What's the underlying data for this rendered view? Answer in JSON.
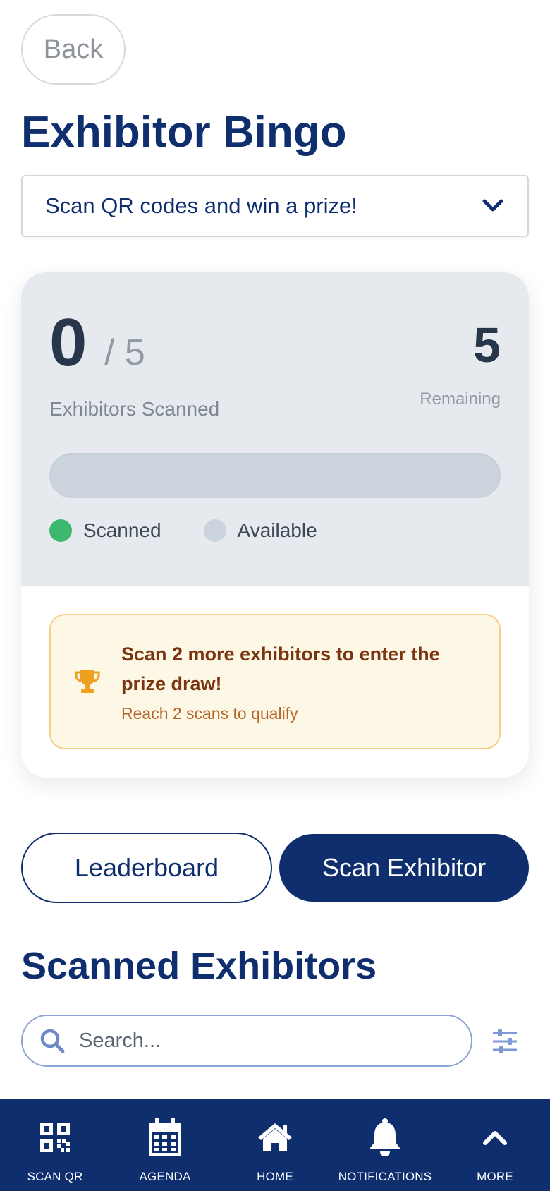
{
  "header": {
    "back_label": "Back",
    "title": "Exhibitor Bingo"
  },
  "dropdown": {
    "label": "Scan QR codes and win a prize!",
    "icon": "chevron-down-icon"
  },
  "progress": {
    "scanned": "0",
    "total": "/ 5",
    "scanned_label": "Exhibitors Scanned",
    "remaining": "5",
    "remaining_label": "Remaining",
    "fill_fraction": 0,
    "legend": {
      "scanned": "Scanned",
      "available": "Available"
    }
  },
  "prize": {
    "title": "Scan 2 more exhibitors to enter the prize draw!",
    "subtitle": "Reach 2 scans to qualify",
    "icon": "trophy-icon"
  },
  "actions": {
    "leaderboard": "Leaderboard",
    "scan": "Scan Exhibitor"
  },
  "scanned_section": {
    "title": "Scanned Exhibitors",
    "search_placeholder": "Search...",
    "search_value": ""
  },
  "nav": [
    {
      "label": "SCAN QR",
      "icon": "qr-code-icon"
    },
    {
      "label": "AGENDA",
      "icon": "calendar-icon"
    },
    {
      "label": "HOME",
      "icon": "home-icon"
    },
    {
      "label": "NOTIFICATIONS",
      "icon": "bell-icon"
    },
    {
      "label": "MORE",
      "icon": "chevron-up-icon"
    }
  ],
  "colors": {
    "primary": "#0f2e6e",
    "scanned_dot": "#3fb86f",
    "available_dot": "#cbd3dc",
    "prize_bg": "#fdf8e6",
    "prize_border": "#f5cf86",
    "trophy": "#f0a020"
  }
}
